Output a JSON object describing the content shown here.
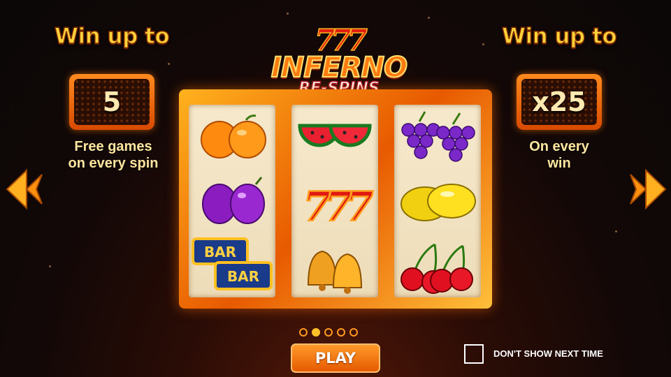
{
  "left_panel": {
    "heading": "Win up to",
    "value": "5",
    "description_line1": "Free games",
    "description_line2": "on every spin"
  },
  "right_panel": {
    "heading": "Win up to",
    "value": "x25",
    "description_line1": "On every",
    "description_line2": "win"
  },
  "logo": {
    "sevens": "777",
    "title": "INFERNO",
    "subtitle": "RE-SPINS"
  },
  "reels": [
    [
      "orange-icon",
      "plum-icon",
      "bar-icon"
    ],
    [
      "watermelon-icon",
      "seven-icon",
      "bell-icon"
    ],
    [
      "grapes-icon",
      "lemon-icon",
      "cherry-icon"
    ]
  ],
  "bar_label": "BAR",
  "seven_label": "777",
  "pagination": {
    "total": 5,
    "active_page": 2
  },
  "play_button": "PLAY",
  "dont_show": {
    "label": "DON'T SHOW NEXT TIME",
    "checked": false
  },
  "colors": {
    "accent": "#ffd23a",
    "button": "#f07010",
    "frame": "#ff8a1e"
  }
}
